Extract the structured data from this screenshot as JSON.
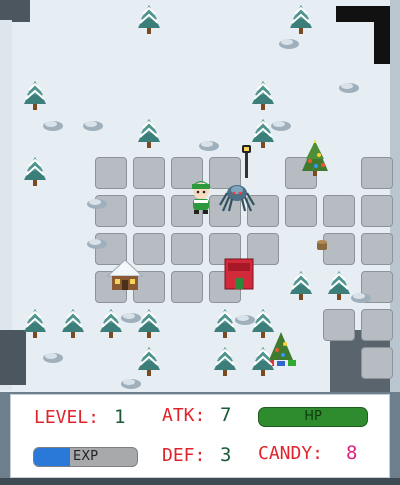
{
  "game": {
    "player": "elf-hero",
    "enemy": "ice-spider",
    "tree_positions_note": "",
    "map": {
      "rows": 10,
      "cols": 10,
      "tiles": [
        "W..T...T.W",
        "..........",
        "T.....T...",
        "...T..T...",
        "T.SSSL.SXS",
        "..SPESSSSS",
        "..SSSSS.SS",
        "..HSSD.TTS",
        "TTTT.TT.SS",
        "W..T.TTX.S"
      ]
    }
  },
  "hud": {
    "level_label": "LEVEL:",
    "level_value": "1",
    "atk_label": "ATK:",
    "atk_value": "7",
    "hp_label": "HP",
    "hp_fraction": 1.0,
    "exp_label": "EXP",
    "exp_fraction": 0.35,
    "def_label": "DEF:",
    "def_value": "3",
    "candy_label": "CANDY:",
    "candy_value": "8"
  },
  "colors": {
    "label_red": "#e0242c",
    "value_green": "#1a5a3a",
    "candy_pink": "#e0227a",
    "hp_green": "#2e8b2e",
    "exp_blue": "#2a78d8"
  }
}
